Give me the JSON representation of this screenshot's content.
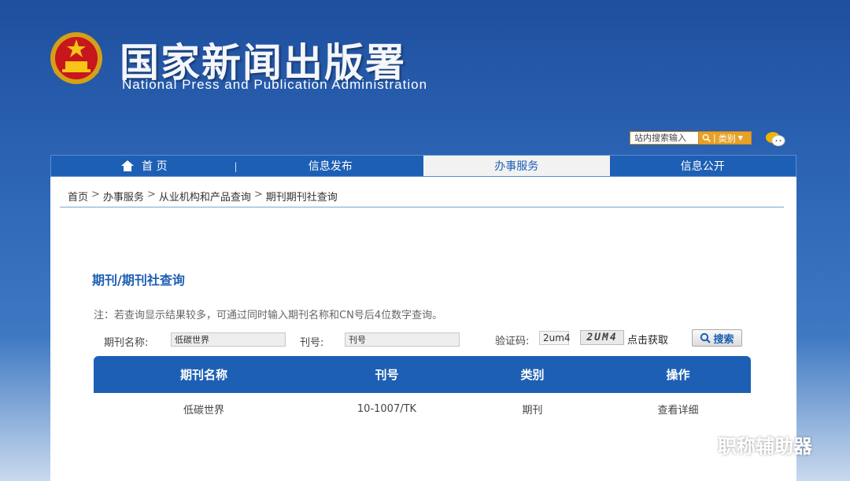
{
  "header": {
    "title": "国家新闻出版署",
    "subtitle": "National  Press and Publication Administration",
    "search_placeholder": "站内搜索输入",
    "category_label": "类别",
    "category_arrow": "▼",
    "search_separator": "|"
  },
  "nav": {
    "items": [
      {
        "label": "首 页"
      },
      {
        "label": "信息发布"
      },
      {
        "label": "办事服务"
      },
      {
        "label": "信息公开"
      }
    ],
    "divider": "|"
  },
  "breadcrumb": {
    "items": [
      "首页",
      "办事服务",
      "从业机构和产品查询",
      "期刊期刊社查询"
    ],
    "separator": ">"
  },
  "page": {
    "title": "期刊/期刊社查询",
    "note": "注：若查询显示结果较多，可通过同时输入期刊名称和CN号后4位数字查询。"
  },
  "form": {
    "name_label": "期刊名称:",
    "name_value": "低碳世界",
    "issn_label": "刊号:",
    "issn_value": "刊号",
    "captcha_label": "验证码:",
    "captcha_value": "2um4",
    "captcha_image_text": "2UM4",
    "captcha_refresh": "点击获取",
    "search_button": "搜索"
  },
  "table": {
    "headers": [
      "期刊名称",
      "刊号",
      "类别",
      "操作"
    ],
    "rows": [
      [
        "低碳世界",
        "10-1007/TK",
        "期刊",
        "查看详细"
      ]
    ]
  },
  "watermark": {
    "text": "职称辅助器"
  },
  "colors": {
    "primary": "#1d5fb4",
    "accent": "#e8a126",
    "background_top": "#1f4f9f"
  }
}
